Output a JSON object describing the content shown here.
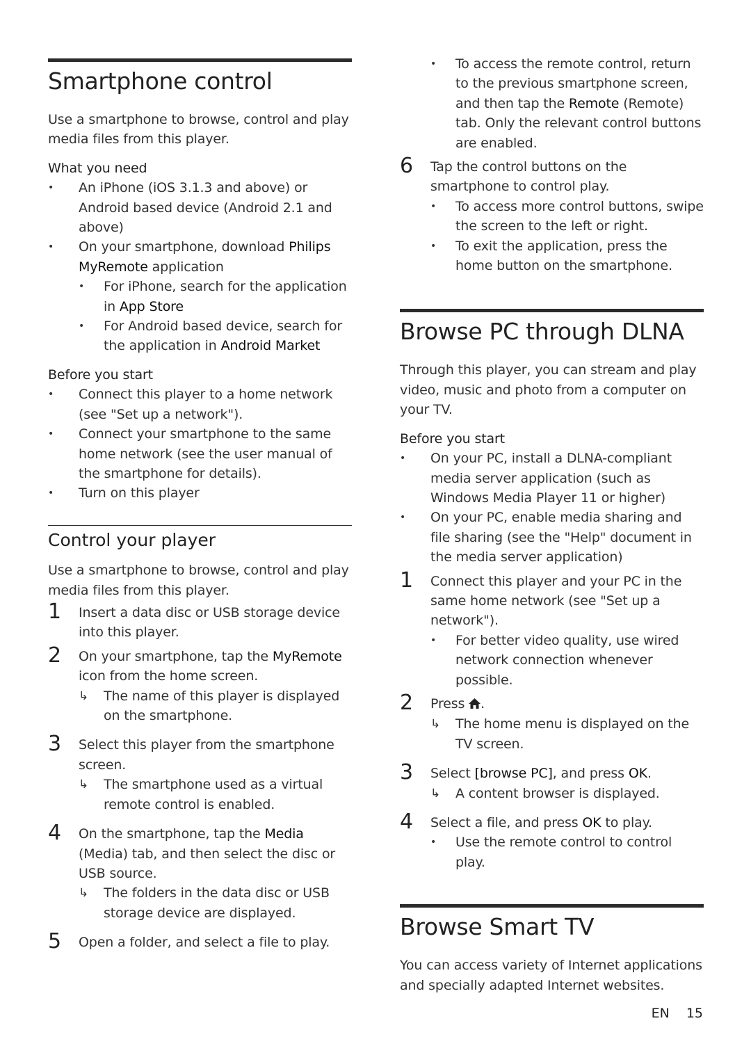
{
  "left": {
    "smartphone": {
      "title": "Smartphone control",
      "intro": "Use a smartphone to browse, control and play media files from this player.",
      "need_heading": "What you need",
      "need_items": [
        "An iPhone (iOS 3.1.3 and above) or Android based device (Android 2.1 and above)"
      ],
      "download_item": {
        "pre": "On your smartphone, download ",
        "em": "Philips MyRemote",
        "post": " application"
      },
      "download_subitems": [
        {
          "pre": "For iPhone, search for the application in ",
          "em": "App Store"
        },
        {
          "pre": "For Android based device, search for the application in ",
          "em": "Android Market"
        }
      ],
      "before_heading": "Before you start",
      "before_items": [
        "Connect this player to a home network (see \"Set up a network\").",
        "Connect your smartphone to the same home network (see the user manual of the smartphone for details).",
        "Turn on this player"
      ]
    },
    "control": {
      "title": "Control your player",
      "intro": "Use a smartphone to browse, control and play media files from this player.",
      "steps": [
        {
          "num": "1",
          "text": "Insert a data disc or USB storage device into this player."
        },
        {
          "num": "2",
          "pre": "On your smartphone, tap the ",
          "em": "MyRemote",
          "post": " icon from the home screen.",
          "result": "The name of this player is displayed on the smartphone."
        },
        {
          "num": "3",
          "text": "Select this player from the smartphone screen.",
          "result": "The smartphone used as a virtual remote control is enabled."
        },
        {
          "num": "4",
          "pre": "On the smartphone, tap the ",
          "em": "Media",
          "post": " (Media) tab, and then select the disc or USB source.",
          "result": "The folders in the data disc or USB storage device are displayed."
        },
        {
          "num": "5",
          "text": "Open a folder, and select a file to play."
        }
      ]
    }
  },
  "right": {
    "continued": {
      "bullet": {
        "pre": "To access the remote control, return to the previous smartphone screen, and then tap the ",
        "em": "Remote",
        "post": " (Remote) tab. Only the relevant control buttons are enabled."
      },
      "step6": {
        "num": "6",
        "text": "Tap the control buttons on the smartphone to control play."
      },
      "step6_bullets": [
        "To access more control buttons, swipe the screen to the left or right.",
        "To exit the application, press the home button on the smartphone."
      ]
    },
    "dlna": {
      "title": "Browse PC through DLNA",
      "intro": "Through this player, you can stream and play video, music and photo from a computer on your TV.",
      "before_heading": "Before you start",
      "before_items": [
        "On your PC, install a DLNA-compliant media server application (such as Windows Media Player 11 or higher)",
        "On your PC, enable media sharing and file sharing (see the \"Help\" document in the media server application)"
      ],
      "steps": [
        {
          "num": "1",
          "text": "Connect this player and your PC in the same home network (see \"Set up a network\").",
          "bullet": "For better video quality, use wired network connection whenever possible."
        },
        {
          "num": "2",
          "pre": "Press ",
          "icon": "home-icon",
          "post": ".",
          "result": "The home menu is displayed on the TV screen."
        },
        {
          "num": "3",
          "pre": "Select ",
          "em": "[browse PC]",
          "mid": ", and press ",
          "em2": "OK",
          "post": ".",
          "result": "A content browser is displayed."
        },
        {
          "num": "4",
          "pre": "Select a file, and press ",
          "em": "OK",
          "post": " to play.",
          "bullet": "Use the remote control to control play."
        }
      ]
    },
    "smarttv": {
      "title": "Browse Smart TV",
      "intro": "You can access variety of Internet applications and specially adapted Internet websites."
    }
  },
  "footer": {
    "lang": "EN",
    "page": "15"
  }
}
